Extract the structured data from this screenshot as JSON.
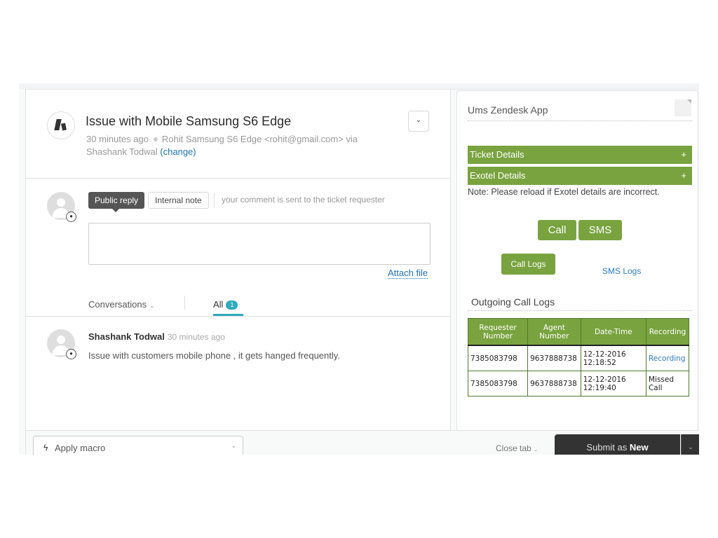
{
  "ticket": {
    "title": "Issue with Mobile Samsung S6 Edge",
    "time_ago": "30 minutes ago",
    "requester": "Rohit Samsung S6 Edge <rohit@gmail.com> via",
    "assignee": "Shashank Todwal",
    "change_link": "(change)",
    "menu_icon": "chevron-down-icon"
  },
  "composer": {
    "public_reply_label": "Public reply",
    "internal_note_label": "Internal note",
    "hint": "your comment is sent to the ticket requester",
    "reply_value": "",
    "attach_file_label": "Attach file"
  },
  "conversations": {
    "filter_label": "Conversations",
    "all_label": "All",
    "all_count": "1"
  },
  "comments": [
    {
      "author": "Shashank Todwal",
      "time": "30 minutes ago",
      "body": "Issue with customers mobile phone , it gets hanged frequently."
    }
  ],
  "footer": {
    "apply_macro_label": "Apply macro",
    "close_tab_label": "Close tab",
    "submit_prefix": "Submit as",
    "submit_status": "New"
  },
  "app": {
    "title": "Ums Zendesk App",
    "accordions": [
      {
        "label": "Ticket Details",
        "toggle": "+"
      },
      {
        "label": "Exotel Details",
        "toggle": "+"
      }
    ],
    "note": "Note: Please reload if Exotel details are incorrect.",
    "call_label": "Call",
    "sms_label": "SMS",
    "call_logs_label": "Call Logs",
    "sms_logs_label": "SMS Logs",
    "outgoing_title": "Outgoing Call Logs",
    "accent_color": "#79a33f",
    "table": {
      "headers": [
        "Requester Number",
        "Agent Number",
        "Date-Time",
        "Recording"
      ],
      "rows": [
        {
          "requester": "7385083798",
          "agent": "9637888738",
          "date": "12-12-2016",
          "time": "12:18:52",
          "recording": "Recording",
          "recording_is_link": true
        },
        {
          "requester": "7385083798",
          "agent": "9637888738",
          "date": "12-12-2016",
          "time": "12:19:40",
          "recording": "Missed Call",
          "recording_is_link": false
        }
      ]
    }
  }
}
